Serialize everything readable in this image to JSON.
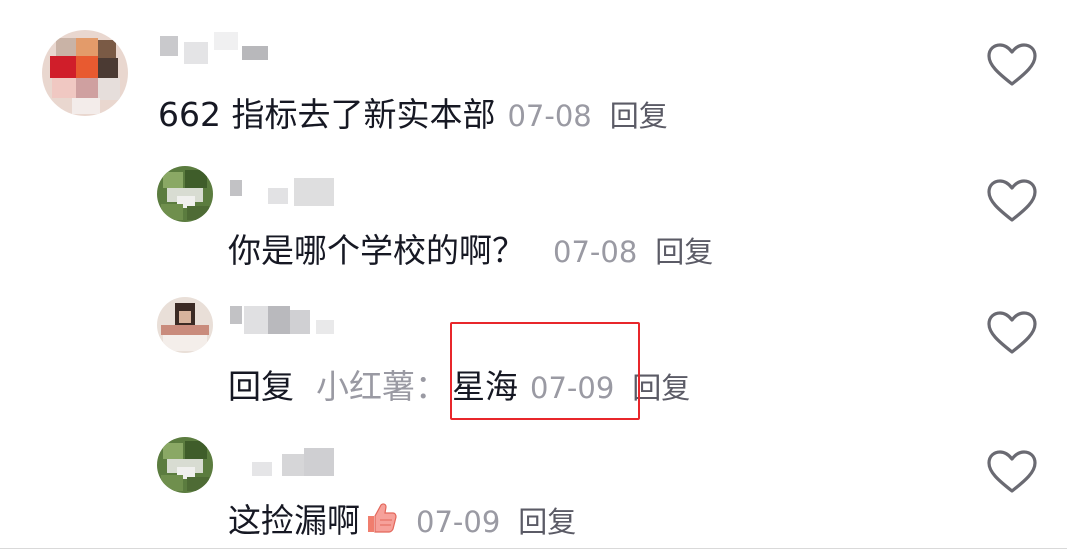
{
  "comments": [
    {
      "text": "662 指标去了新实本部",
      "date": "07-08",
      "reply_label": "回复"
    },
    {
      "text": "你是哪个学校的啊？",
      "date": "07-08",
      "reply_label": "回复"
    },
    {
      "reply_prefix": "回复",
      "mention": "小红薯：",
      "text": "星海",
      "date": "07-09",
      "reply_label": "回复"
    },
    {
      "text": "这捡漏啊",
      "emoji": "thumbs-up-emoji",
      "date": "07-09",
      "reply_label": "回复"
    }
  ],
  "icons": {
    "like": "heart-outline-icon"
  },
  "colors": {
    "highlight": "#e8262b",
    "text": "#161823",
    "muted": "#9a9aa3"
  }
}
